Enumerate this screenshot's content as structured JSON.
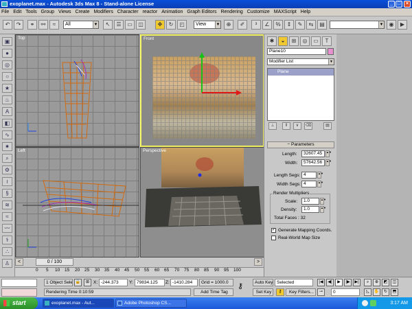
{
  "window": {
    "title": "exoplanet.max - Autodesk 3ds Max 8  - Stand-alone License"
  },
  "menu": [
    "File",
    "Edit",
    "Tools",
    "Group",
    "Views",
    "Create",
    "Modifiers",
    "Character",
    "reactor",
    "Animation",
    "Graph Editors",
    "Rendering",
    "Customize",
    "MAXScript",
    "Help"
  ],
  "toolbar": {
    "selection_filter": "All",
    "ref_coord": "View"
  },
  "viewports": {
    "top": "Top",
    "front": "Front",
    "left": "Left",
    "perspective": "Perspective"
  },
  "timeline": {
    "slider": "0 / 100",
    "ticks": [
      "0",
      "5",
      "10",
      "15",
      "20",
      "25",
      "30",
      "35",
      "40",
      "45",
      "50",
      "55",
      "60",
      "65",
      "70",
      "75",
      "80",
      "85",
      "90",
      "95",
      "100"
    ]
  },
  "command_panel": {
    "object_name": "Plane10",
    "object_color": "#e890d0",
    "modifier_list": "Modifier List",
    "stack_item": "Plane",
    "rollout_title": "Parameters",
    "length_label": "Length:",
    "length_value": "32607.45",
    "width_label": "Width:",
    "width_value": "57642.56",
    "length_segs_label": "Length Segs:",
    "length_segs_value": "4",
    "width_segs_label": "Width Segs:",
    "width_segs_value": "4",
    "render_multipliers": "Render Multipliers",
    "scale_label": "Scale:",
    "scale_value": "1.0",
    "density_label": "Density:",
    "density_value": "1.0",
    "total_faces": "Total Faces : 32",
    "gen_mapping": "Generate Mapping Coords.",
    "gen_mapping_checked": true,
    "real_world": "Real-World Map Size",
    "real_world_checked": false
  },
  "status": {
    "selection": "1 Object Sele",
    "x_label": "X:",
    "x_value": "-244.373",
    "y_label": "Y:",
    "y_value": "79834.125",
    "z_label": "Z:",
    "z_value": "-1410.284",
    "grid": "Grid = 1000.0",
    "auto_key": "Auto Key",
    "set_key": "Set Key",
    "key_mode": "Selected",
    "key_filters": "Key Filters...",
    "frame": "0",
    "render_time": "Rendering Time  0:10:59",
    "add_time_tag": "Add Time Tag"
  },
  "taskbar": {
    "start": "start",
    "tasks": [
      "exoplanet.max - Aut...",
      "Adobe Photoshop CS..."
    ],
    "clock": "3:17 AM"
  }
}
